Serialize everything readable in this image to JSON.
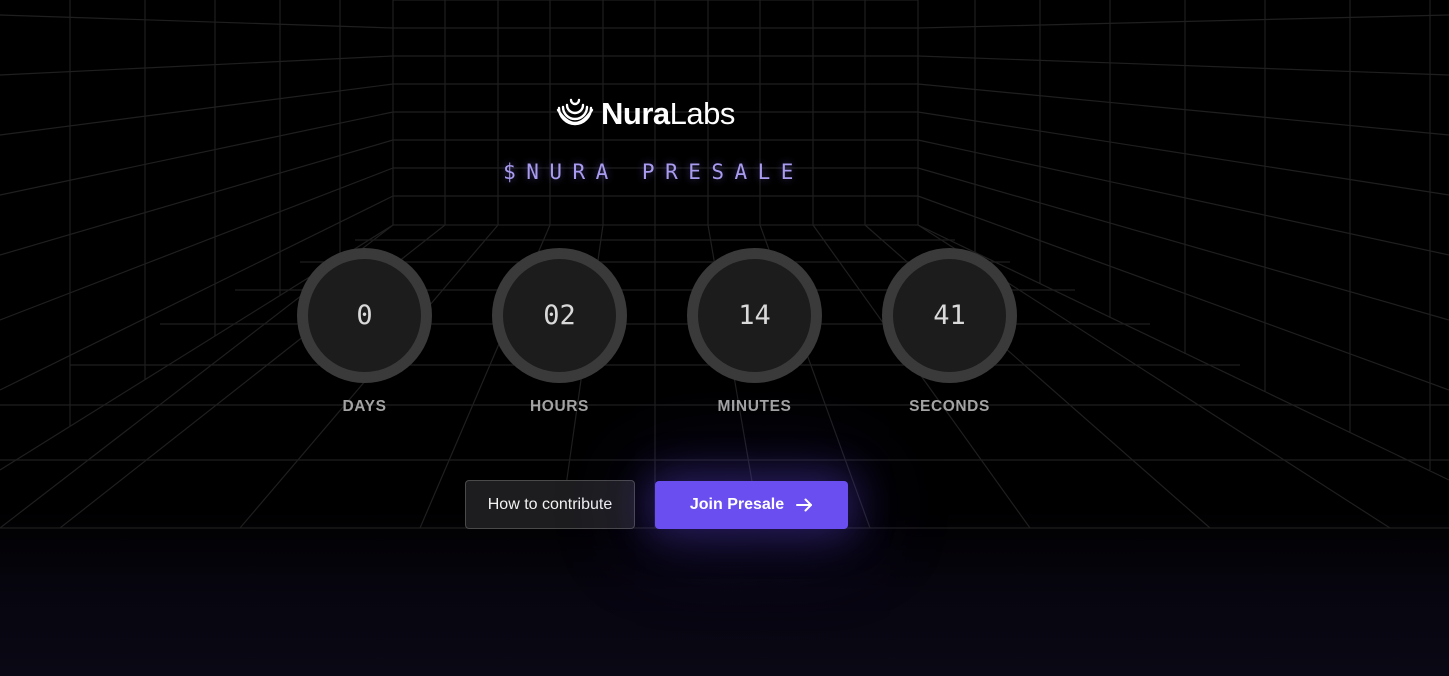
{
  "brand": {
    "name_bold": "Nura",
    "name_light": "Labs",
    "logo_icon": "nura-wave-icon"
  },
  "presale": {
    "title": "$NURA PRESALE"
  },
  "countdown": [
    {
      "value": "0",
      "label": "DAYS"
    },
    {
      "value": "02",
      "label": "HOURS"
    },
    {
      "value": "14",
      "label": "MINUTES"
    },
    {
      "value": "41",
      "label": "SECONDS"
    }
  ],
  "actions": {
    "secondary_label": "How to contribute",
    "primary_label": "Join Presale",
    "primary_icon": "arrow-right-icon"
  },
  "colors": {
    "accent": "#6b4ef0",
    "title": "#a99cf0",
    "background": "#000000"
  }
}
